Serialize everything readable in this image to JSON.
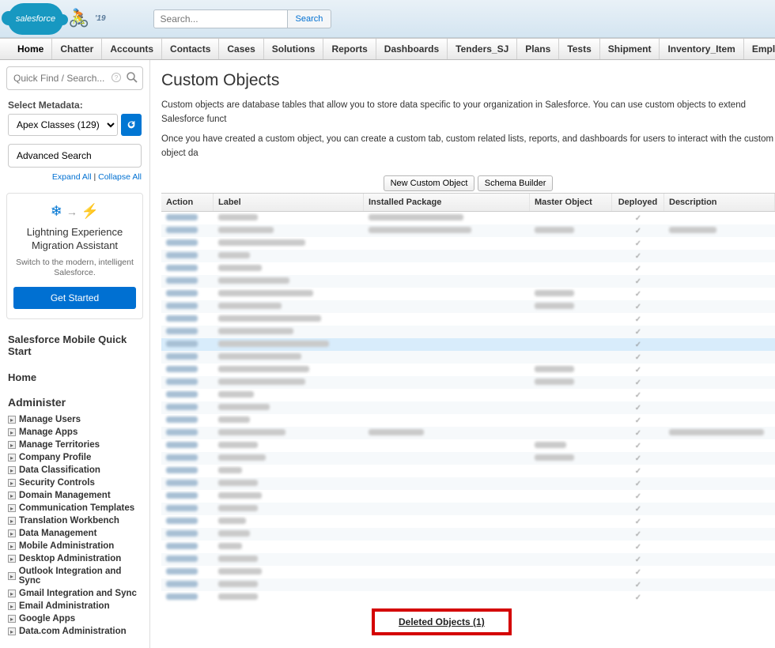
{
  "header": {
    "logo_text": "salesforce",
    "season": "'19",
    "search_placeholder": "Search...",
    "search_button": "Search"
  },
  "nav": [
    "Home",
    "Chatter",
    "Accounts",
    "Contacts",
    "Cases",
    "Solutions",
    "Reports",
    "Dashboards",
    "Tenders_SJ",
    "Plans",
    "Tests",
    "Shipment",
    "Inventory_Item",
    "Employee Certification Details"
  ],
  "sidebar": {
    "quickfind_placeholder": "Quick Find / Search...",
    "metadata_label": "Select Metadata:",
    "metadata_selected": "Apex Classes (129)",
    "advanced_search": "Advanced Search",
    "expand_all": "Expand All",
    "collapse_all": "Collapse All",
    "promo": {
      "title": "Lightning Experience Migration Assistant",
      "subtitle": "Switch to the modern, intelligent Salesforce.",
      "button": "Get Started"
    },
    "quickstart_title": "Salesforce Mobile Quick Start",
    "home_title": "Home",
    "administer_title": "Administer",
    "administer_items": [
      "Manage Users",
      "Manage Apps",
      "Manage Territories",
      "Company Profile",
      "Data Classification",
      "Security Controls",
      "Domain Management",
      "Communication Templates",
      "Translation Workbench",
      "Data Management",
      "Mobile Administration",
      "Desktop Administration",
      "Outlook Integration and Sync",
      "Gmail Integration and Sync",
      "Email Administration",
      "Google Apps",
      "Data.com Administration"
    ]
  },
  "page": {
    "title": "Custom Objects",
    "desc1": "Custom objects are database tables that allow you to store data specific to your organization in Salesforce. You can use custom objects to extend Salesforce funct",
    "desc2": "Once you have created a custom object, you can create a custom tab, custom related lists, reports, and dashboards for users to interact with the custom object da",
    "new_button": "New Custom Object",
    "schema_button": "Schema Builder",
    "columns": {
      "action": "Action",
      "label": "Label",
      "pkg": "Installed Package",
      "master": "Master Object",
      "deployed": "Deployed",
      "desc": "Description"
    },
    "deleted_link": "Deleted Objects (1)"
  }
}
